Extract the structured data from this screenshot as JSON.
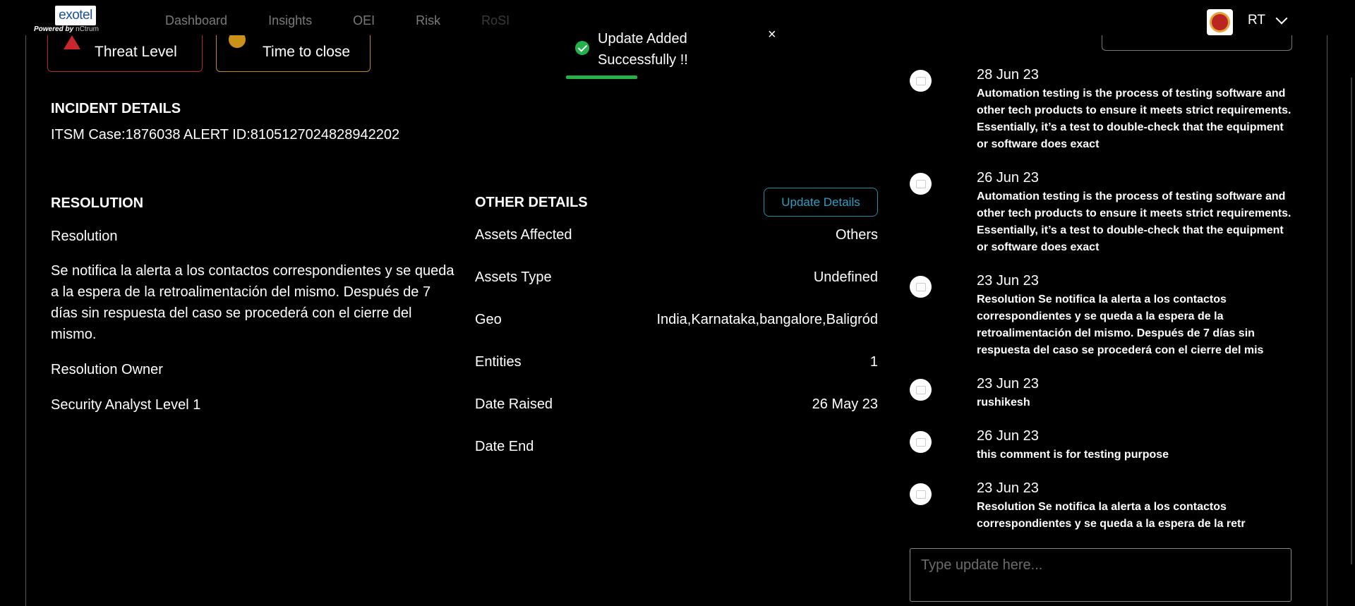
{
  "brand": {
    "logo_text": "exotel",
    "powered_by": "Powered by",
    "partner": "nCtrum"
  },
  "nav": {
    "items": [
      {
        "label": "Dashboard"
      },
      {
        "label": "Insights"
      },
      {
        "label": "OEI"
      },
      {
        "label": "Risk"
      },
      {
        "label": "RoSI"
      }
    ]
  },
  "user": {
    "initials": "RT"
  },
  "toast": {
    "message": "Update Added Successfully !!",
    "close": "×"
  },
  "metrics": {
    "threat_label": "Threat Level",
    "time_label": "Time to close"
  },
  "incident": {
    "heading": "INCIDENT DETAILS",
    "ids": "ITSM Case:1876038 ALERT ID:8105127024828942202"
  },
  "resolution": {
    "heading": "RESOLUTION",
    "label": "Resolution",
    "text": "Se notifica la alerta a los contactos correspondientes y se queda a la espera de la retroalimentación del mismo. Después de 7 días sin respuesta del caso se procederá con el cierre del mismo.",
    "owner_label": "Resolution Owner",
    "owner_value": "Security Analyst Level 1"
  },
  "other_details": {
    "heading": "OTHER DETAILS",
    "update_button": "Update Details",
    "rows": [
      {
        "key": "Assets Affected",
        "value": "Others"
      },
      {
        "key": "Assets Type",
        "value": "Undefined"
      },
      {
        "key": "Geo",
        "value": "India,Karnataka,bangalore,Baligród"
      },
      {
        "key": "Entities",
        "value": "1"
      },
      {
        "key": "Date Raised",
        "value": "26 May 23"
      },
      {
        "key": "Date End",
        "value": ""
      }
    ]
  },
  "timeline": [
    {
      "date": "28 Jun 23",
      "text": "Automation testing is the process of testing software and other tech products to ensure it meets strict requirements. Essentially, it’s a test to double-check that the equipment or software does exact"
    },
    {
      "date": "26 Jun 23",
      "text": "Automation testing is the process of testing software and other tech products to ensure it meets strict requirements. Essentially, it’s a test to double-check that the equipment or software does exact"
    },
    {
      "date": "23 Jun 23",
      "text": "Resolution Se notifica la alerta a los contactos correspondientes y se queda a la espera de la retroalimentación del mismo. Después de 7 días sin respuesta del caso se procederá con el cierre del mis"
    },
    {
      "date": "23 Jun 23",
      "text": "rushikesh"
    },
    {
      "date": "26 Jun 23",
      "text": "this comment is for testing purpose"
    },
    {
      "date": "23 Jun 23",
      "text": "Resolution Se notifica la alerta a los contactos correspondientes y se queda a la espera de la retr"
    }
  ],
  "comment": {
    "placeholder": "Type update here..."
  }
}
